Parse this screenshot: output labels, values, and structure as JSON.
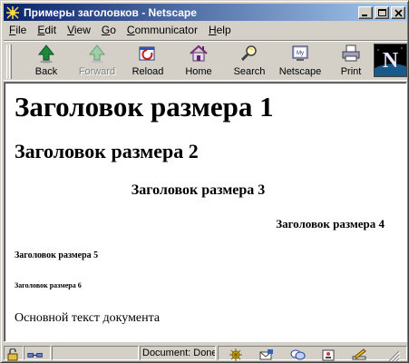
{
  "window": {
    "title": "Примеры заголовков - Netscape"
  },
  "menu": {
    "items": [
      {
        "accel": "F",
        "rest": "ile"
      },
      {
        "accel": "E",
        "rest": "dit"
      },
      {
        "accel": "V",
        "rest": "iew"
      },
      {
        "accel": "G",
        "rest": "o"
      },
      {
        "accel": "C",
        "rest": "ommunicator"
      },
      {
        "accel": "H",
        "rest": "elp"
      }
    ]
  },
  "toolbar": {
    "back": "Back",
    "forward": "Forward",
    "reload": "Reload",
    "home": "Home",
    "search": "Search",
    "netscape": "Netscape",
    "print": "Print",
    "logo_letter": "N"
  },
  "page": {
    "h1": "Заголовок размера 1",
    "h2": "Заголовок размера 2",
    "h3": "Заголовок размера 3",
    "h4": "Заголовок размера 4",
    "h5": "Заголовок размера 5",
    "h6": "Заголовок размера 6",
    "body": "Основной текст документа"
  },
  "status": {
    "text": "Document: Done"
  },
  "colors": {
    "title_start": "#0a246a",
    "title_end": "#a6caf0",
    "chrome": "#d4d0c8"
  }
}
